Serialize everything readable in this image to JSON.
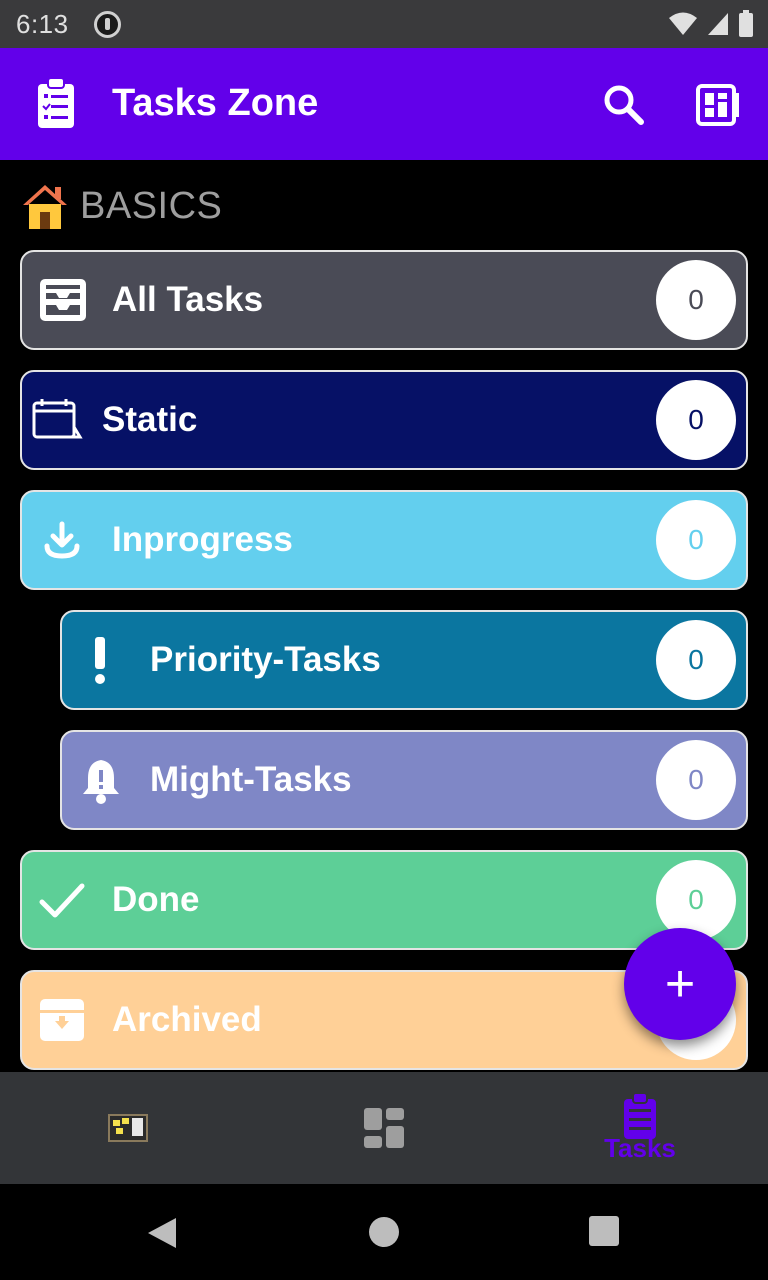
{
  "status_bar": {
    "time": "6:13"
  },
  "app_bar": {
    "title": "Tasks Zone",
    "icons": [
      "clipboard-list-icon",
      "search-icon",
      "layout-grid-icon"
    ]
  },
  "section": {
    "label": "BASICS",
    "icon": "house-icon"
  },
  "rows": [
    {
      "label": "All Tasks",
      "count": "0",
      "icon": "inbox-tray-icon",
      "bg": "#4a4b56",
      "count_color": "#4a4b56"
    },
    {
      "label": "Static",
      "count": "0",
      "icon": "calendar-icon",
      "bg": "#061166",
      "count_color": "#061166"
    },
    {
      "label": "Inprogress",
      "count": "0",
      "icon": "download-icon",
      "bg": "#63cfee",
      "count_color": "#63cfee"
    },
    {
      "label": "Priority-Tasks",
      "count": "0",
      "icon": "exclamation-icon",
      "bg": "#0b76a0",
      "count_color": "#0b76a0"
    },
    {
      "label": "Might-Tasks",
      "count": "0",
      "icon": "bell-alert-icon",
      "bg": "#7f87c6",
      "count_color": "#7f87c6"
    },
    {
      "label": "Done",
      "count": "0",
      "icon": "check-icon",
      "bg": "#5dcf97",
      "count_color": "#5dcf97"
    },
    {
      "label": "Archived",
      "count": "0",
      "icon": "archive-box-icon",
      "bg": "#ffd097",
      "count_color": "#ffd097"
    }
  ],
  "fab": {
    "symbol": "+",
    "icon": "plus-icon",
    "color": "#6200ea"
  },
  "bottom_nav": {
    "items": [
      {
        "icon": "notes-board-icon",
        "label": ""
      },
      {
        "icon": "dashboard-icon",
        "label": ""
      },
      {
        "icon": "clipboard-list-icon",
        "label": "Tasks",
        "active": true
      }
    ],
    "accent": "#6200ea"
  },
  "colors": {
    "primary": "#6200ea",
    "background": "#000000"
  }
}
